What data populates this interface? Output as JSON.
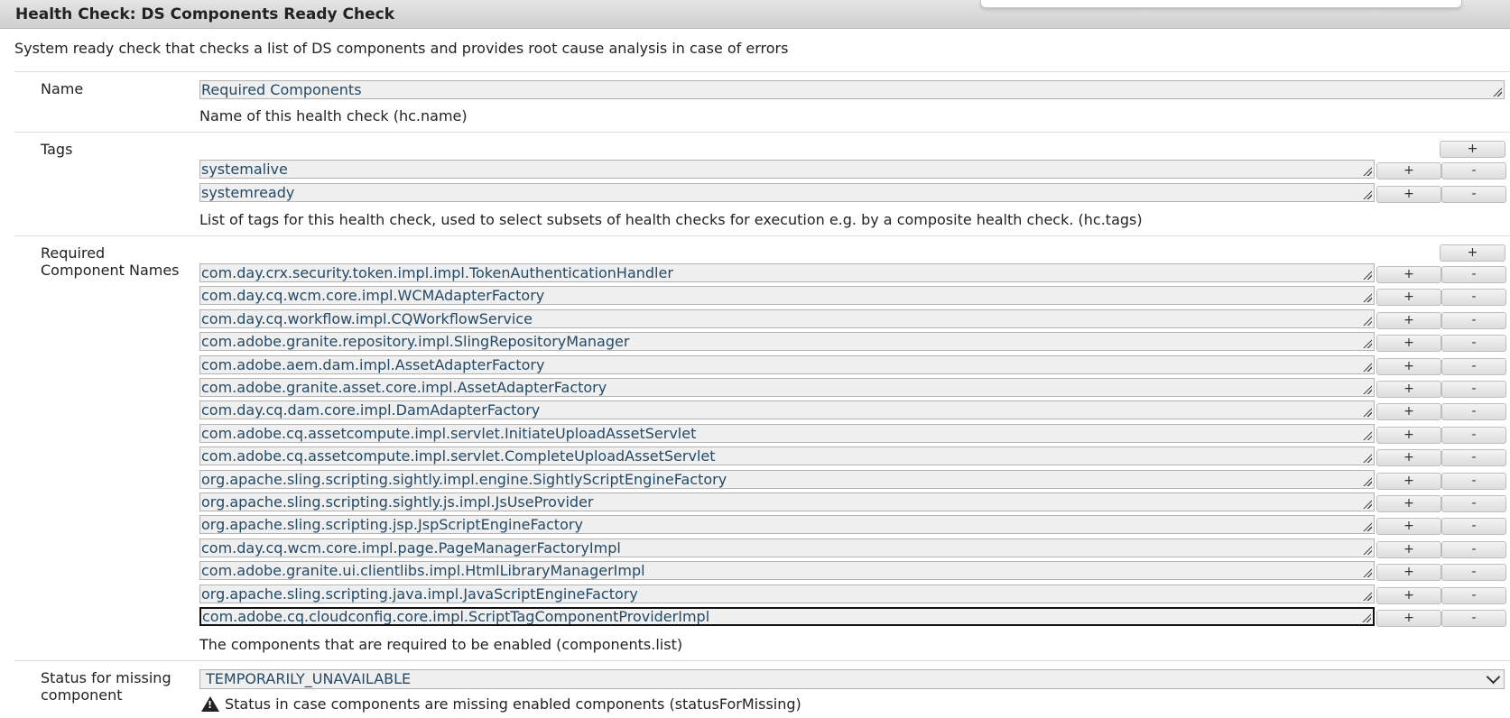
{
  "window": {
    "title": "Health Check: DS Components Ready Check"
  },
  "description": "System ready check that checks a list of DS components and provides root cause analysis in case of errors",
  "name_field": {
    "label": "Name",
    "value": "Required Components",
    "hint": "Name of this health check (hc.name)"
  },
  "tags_field": {
    "label": "Tags",
    "values": [
      "systemalive",
      "systemready"
    ],
    "hint": "List of tags for this health check, used to select subsets of health checks for execution e.g. by a composite health check. (hc.tags)"
  },
  "components_field": {
    "label_line1": "Required",
    "label_line2": "Component Names",
    "values": [
      "com.day.crx.security.token.impl.impl.TokenAuthenticationHandler",
      "com.day.cq.wcm.core.impl.WCMAdapterFactory",
      "com.day.cq.workflow.impl.CQWorkflowService",
      "com.adobe.granite.repository.impl.SlingRepositoryManager",
      "com.adobe.aem.dam.impl.AssetAdapterFactory",
      "com.adobe.granite.asset.core.impl.AssetAdapterFactory",
      "com.day.cq.dam.core.impl.DamAdapterFactory",
      "com.adobe.cq.assetcompute.impl.servlet.InitiateUploadAssetServlet",
      "com.adobe.cq.assetcompute.impl.servlet.CompleteUploadAssetServlet",
      "org.apache.sling.scripting.sightly.impl.engine.SightlyScriptEngineFactory",
      "org.apache.sling.scripting.sightly.js.impl.JsUseProvider",
      "org.apache.sling.scripting.jsp.JspScriptEngineFactory",
      "com.day.cq.wcm.core.impl.page.PageManagerFactoryImpl",
      "com.adobe.granite.ui.clientlibs.impl.HtmlLibraryManagerImpl",
      "org.apache.sling.scripting.java.impl.JavaScriptEngineFactory",
      "com.adobe.cq.cloudconfig.core.impl.ScriptTagComponentProviderImpl"
    ],
    "hint": "The components that are required to be enabled (components.list)"
  },
  "status_field": {
    "label_line1": "Status for missing",
    "label_line2": "component",
    "selected": "TEMPORARILY_UNAVAILABLE",
    "hint": "Status in case components are missing enabled components (statusForMissing)"
  },
  "buttons": {
    "plus": "+",
    "minus": "-"
  }
}
